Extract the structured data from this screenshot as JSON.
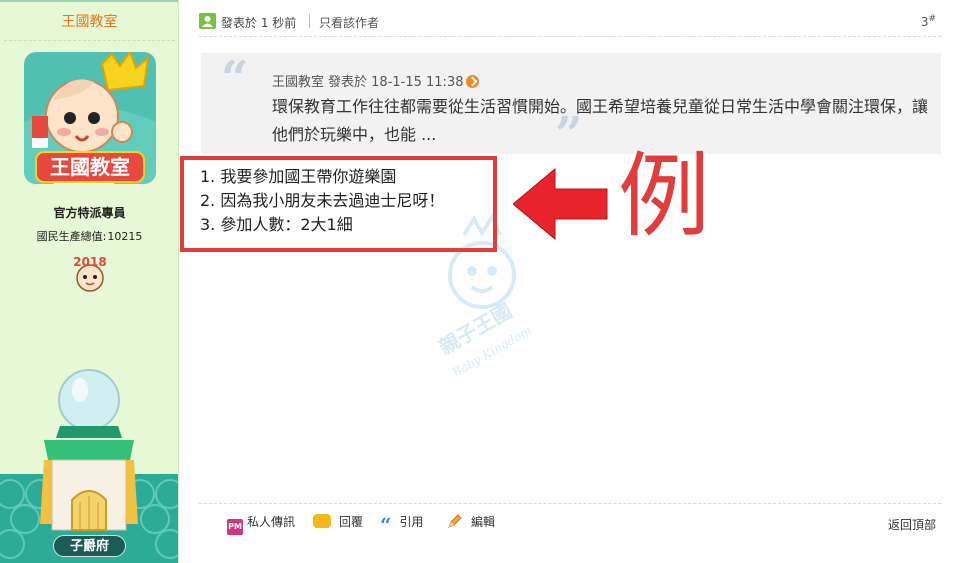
{
  "sidebar": {
    "username": "王國教室",
    "role": "官方特派專員",
    "gnp_label": "國民生產總值:",
    "gnp_value": "10215",
    "rank": "子爵府",
    "avatar_text": "王國教室",
    "badge_text": "2018"
  },
  "post": {
    "time": "發表於 1 秒前",
    "author_only": "只看該作者",
    "floor": "3",
    "floor_suffix": "#",
    "quote": {
      "author": "王國教室",
      "time": "發表於 18-1-15 11:38",
      "text": "環保教育工作往往都需要從生活習慣開始。國王希望培養兒童從日常生活中學會關注環保，讓他們於玩樂中，也能 ..."
    },
    "lines": [
      "1. 我要參加國王帶你遊樂園",
      "2. 因為我小朋友未去過迪士尼呀！",
      "3. 參加人數：2大1細"
    ],
    "example_label": "例"
  },
  "watermark": {
    "title": "親子王國",
    "subtitle": "Baby Kingdom"
  },
  "actions": {
    "pm": "私人傳訊",
    "pm_icon_text": "PM",
    "reply": "回覆",
    "quote": "引用",
    "edit": "編輯",
    "back_top": "返回頂部"
  },
  "colors": {
    "sidebar_bg": "#e6f8d5",
    "username": "#e8761a",
    "highlight_red": "#e23c3c",
    "rank_badge": "#1d5b57"
  }
}
